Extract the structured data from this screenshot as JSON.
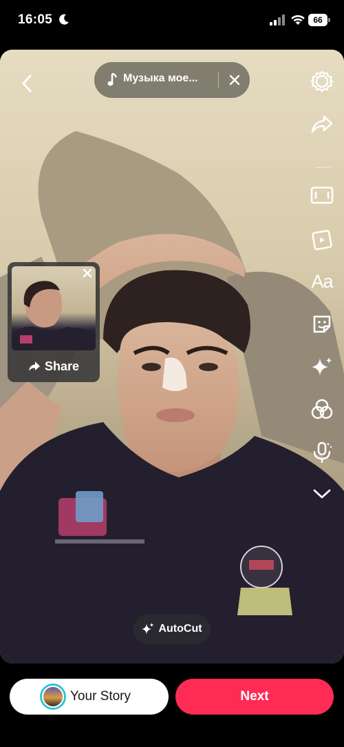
{
  "status_bar": {
    "time": "16:05",
    "battery": "66",
    "icons": [
      "moon-icon",
      "signal-icon",
      "wifi-icon",
      "battery-icon"
    ]
  },
  "top": {
    "back_icon": "chevron-left-icon",
    "music_title": "Музыка мое...",
    "music_icon": "music-note-icon",
    "close_icon": "close-icon"
  },
  "sidebar": {
    "icons": [
      "settings-icon",
      "forward-icon",
      "aspect-ratio-icon",
      "templates-icon",
      "text-icon",
      "sticker-icon",
      "effects-icon",
      "filters-icon",
      "voice-icon",
      "chevron-down-icon"
    ],
    "text_icon_label": "Aa"
  },
  "share_popup": {
    "label": "Share",
    "close_icon": "close-icon",
    "share_icon": "share-arrow-icon"
  },
  "autocut": {
    "label": "AutoCut",
    "icon": "sparkle-icon"
  },
  "bottom": {
    "story_label": "Your Story",
    "next_label": "Next"
  },
  "colors": {
    "accent": "#fe2c55",
    "story_ring": "#2ec4d6",
    "background": "#000000"
  }
}
